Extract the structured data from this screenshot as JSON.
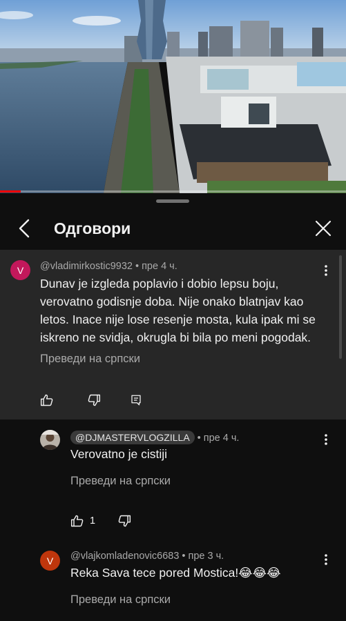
{
  "video": {
    "progress_fraction": 0.06,
    "accent_color": "#ff0000"
  },
  "header": {
    "title": "Одговори",
    "back_icon": "chevron-left-icon",
    "close_icon": "close-icon"
  },
  "top_comment": {
    "avatar_letter": "V",
    "avatar_color": "#c2185b",
    "username": "@vladimirkostic9932",
    "separator": "•",
    "time": "пре 4 ч.",
    "lines": [
      "Dunav je izgleda poplavio i dobio lepsu boju,",
      "verovatno godisnje doba. Nije onako blatnjav kao",
      "letos. Inace nije lose resenje mosta, kula ipak mi se",
      "iskreno ne svidja, okrugla bi bila po meni pogodak."
    ],
    "translate": "Преведи на српски"
  },
  "replies": [
    {
      "username": "@DJMASTERVLOGZILLA",
      "separator": "•",
      "time": "пре 4 ч.",
      "text": "Verovatno je cistiji",
      "translate": "Преведи на српски",
      "likes": "1"
    },
    {
      "avatar_letter": "V",
      "avatar_color": "#bf360c",
      "username": "@vlajkomladenovic6683",
      "separator": "•",
      "time": "пре 3 ч.",
      "text": "Reka Sava tece pored Mostica!😂😂😂",
      "translate": "Преведи на српски"
    }
  ]
}
